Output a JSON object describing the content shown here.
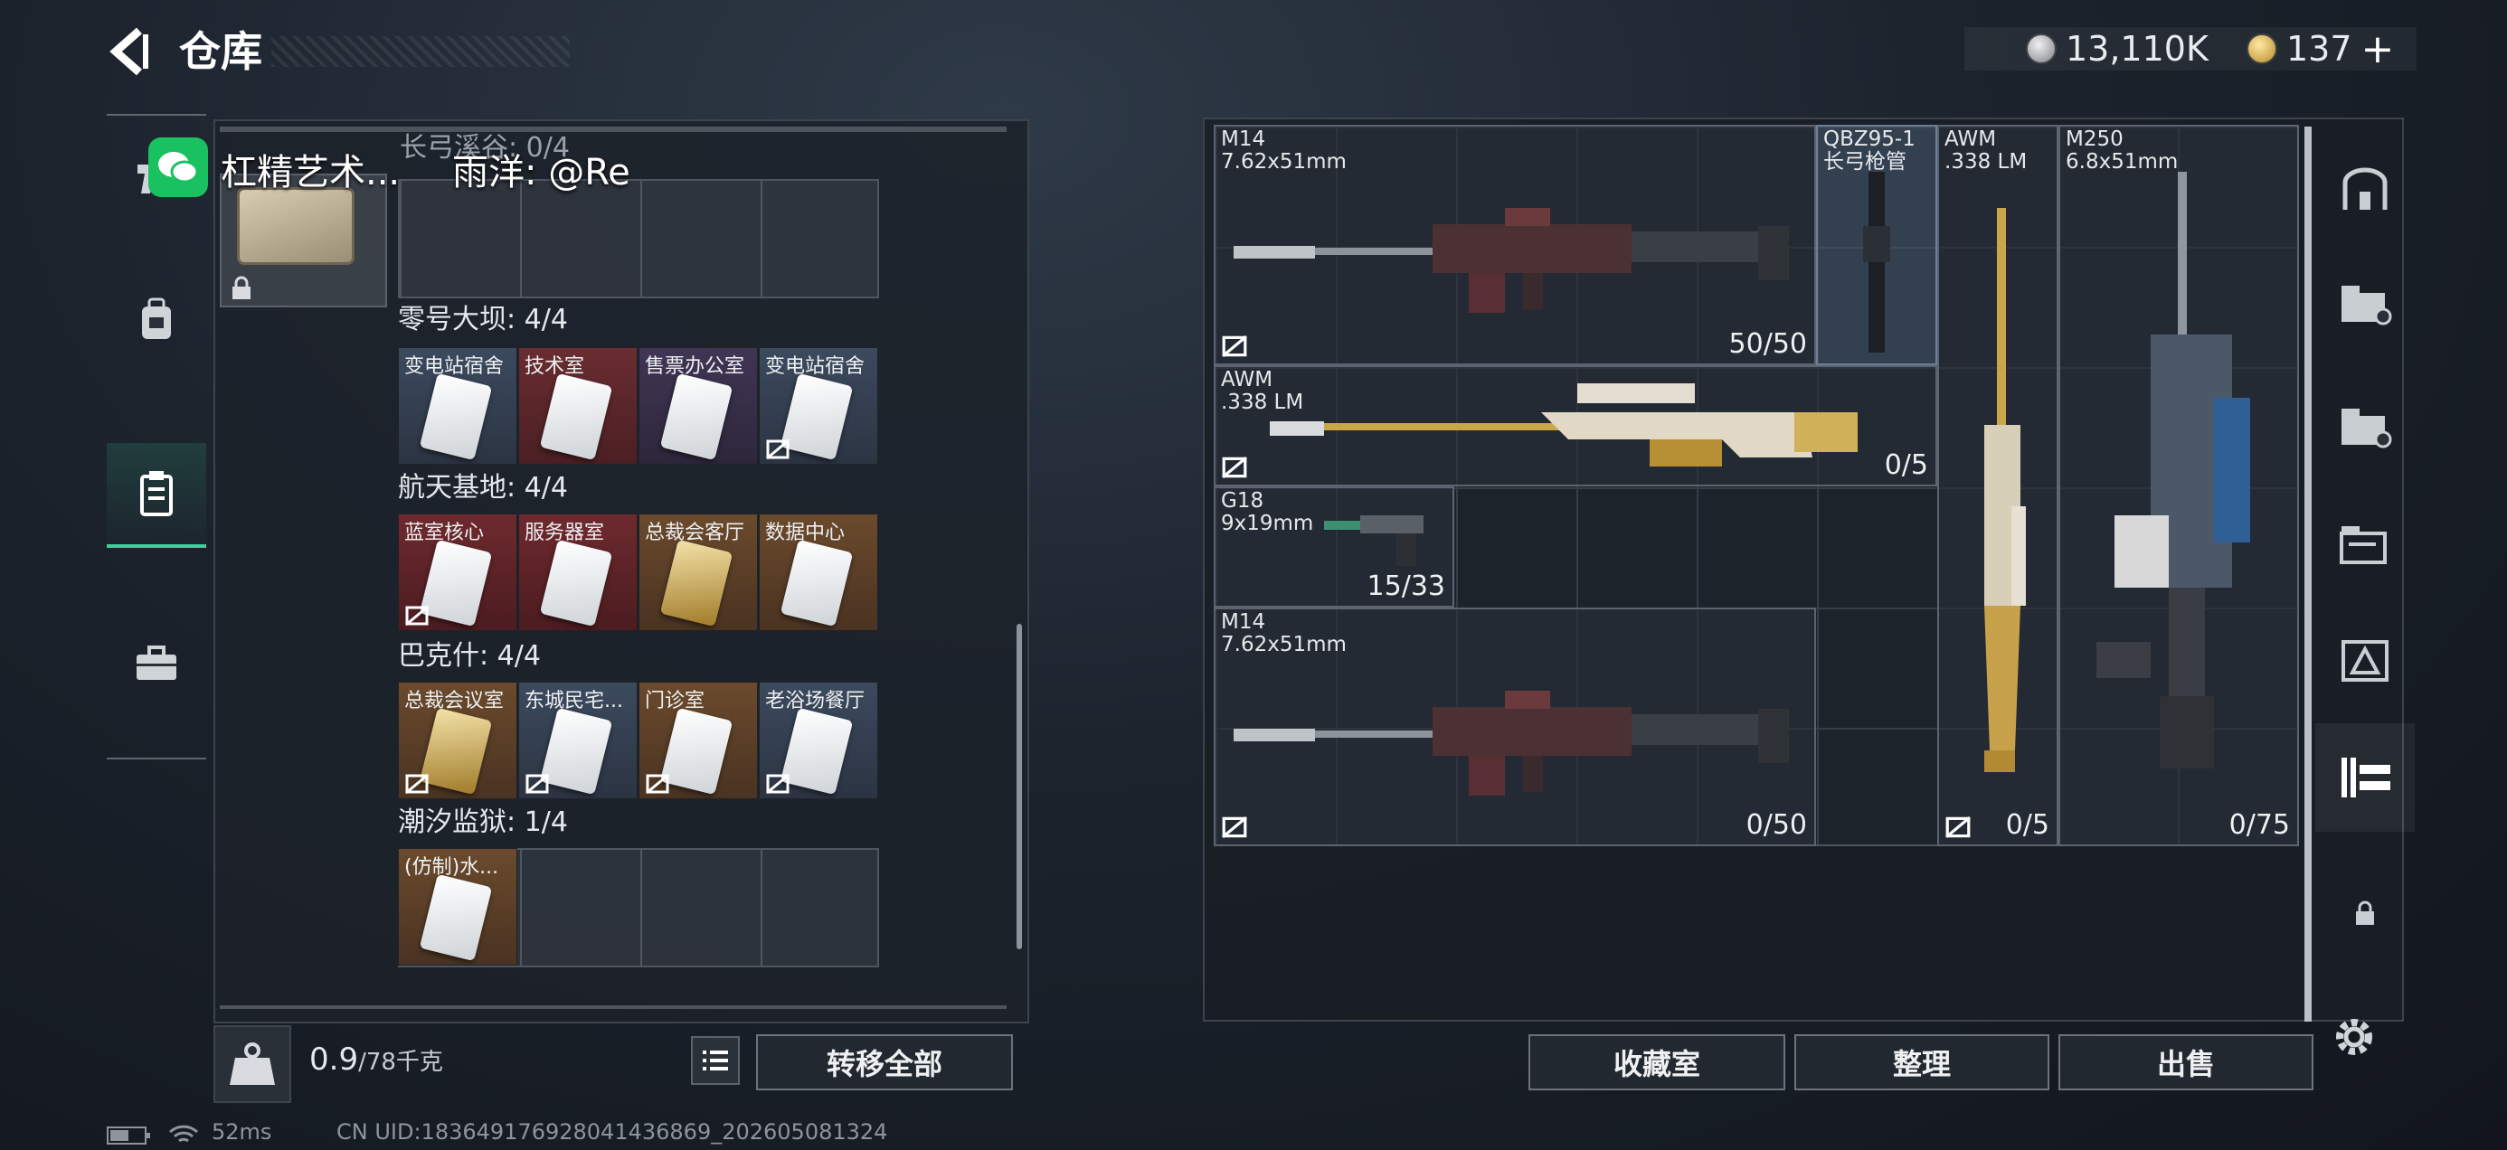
{
  "header": {
    "title": "仓库",
    "currency_silver": "13,110K",
    "currency_gold": "137",
    "add_label": "+"
  },
  "overlay": {
    "share_name": "杠精艺术...",
    "share_user": "雨洋: @Re",
    "header_partial": "长弓溪谷: 0/4"
  },
  "left_nav": {
    "items": [
      {
        "icon": "pistol-icon"
      },
      {
        "icon": "backpack-icon"
      },
      {
        "icon": "keycard-case-icon"
      },
      {
        "icon": "toolbox-icon"
      }
    ],
    "active_index": 2
  },
  "keycards": {
    "groups": [
      {
        "label": "零号大坝: 4/4",
        "cards": [
          {
            "name": "变电站宿舍",
            "color": "blue"
          },
          {
            "name": "技术室",
            "color": "red"
          },
          {
            "name": "售票办公室",
            "color": "purple"
          },
          {
            "name": "变电站宿舍",
            "color": "blue"
          }
        ]
      },
      {
        "label": "航天基地: 4/4",
        "cards": [
          {
            "name": "蓝室核心",
            "color": "red"
          },
          {
            "name": "服务器室",
            "color": "red"
          },
          {
            "name": "总裁会客厅",
            "color": "brown"
          },
          {
            "name": "数据中心",
            "color": "brown"
          }
        ]
      },
      {
        "label": "巴克什: 4/4",
        "cards": [
          {
            "name": "总裁会议室",
            "color": "brown"
          },
          {
            "name": "东城民宅...",
            "color": "blue"
          },
          {
            "name": "门诊室",
            "color": "brown"
          },
          {
            "name": "老浴场餐厅",
            "color": "blue"
          }
        ]
      },
      {
        "label": "潮汐监狱: 1/4",
        "cards": [
          {
            "name": "(仿制)水...",
            "color": "brown"
          }
        ]
      }
    ]
  },
  "bottom_left": {
    "weight_value": "0.9",
    "weight_max": "/78千克",
    "transfer_all": "转移全部"
  },
  "weapons": [
    {
      "name": "M14\n7.62x51mm",
      "ammo": "50/50"
    },
    {
      "name": "QBZ95-1\n长弓枪管",
      "ammo": ""
    },
    {
      "name": "AWM\n.338 LM",
      "ammo": "0/5"
    },
    {
      "name": "M250\n6.8x51mm",
      "ammo": "0/75"
    },
    {
      "name": "AWM\n.338 LM",
      "ammo": "0/5"
    },
    {
      "name": "G18\n9x19mm",
      "ammo": "15/33"
    },
    {
      "name": "M14\n7.62x51mm",
      "ammo": "0/50"
    }
  ],
  "bottom_right": {
    "collection": "收藏室",
    "organize": "整理",
    "sell": "出售"
  },
  "right_nav": {
    "items": [
      {
        "icon": "vault-icon"
      },
      {
        "icon": "storage-iv-icon"
      },
      {
        "icon": "storage-iv-icon"
      },
      {
        "icon": "storage-iv-icon"
      },
      {
        "icon": "storage-special-icon"
      },
      {
        "icon": "weapon-rack-icon"
      },
      {
        "icon": "lock-icon"
      }
    ],
    "active_index": 5
  },
  "status": {
    "ping": "52ms",
    "uid": "CN UID:183649176928041436869_202605081324"
  },
  "colors": {
    "accent": "#3ad29a",
    "card_blue": "#3c4a5e",
    "card_red": "#6a2d31",
    "card_purple": "#403555",
    "card_brown": "#6b4a2c"
  }
}
